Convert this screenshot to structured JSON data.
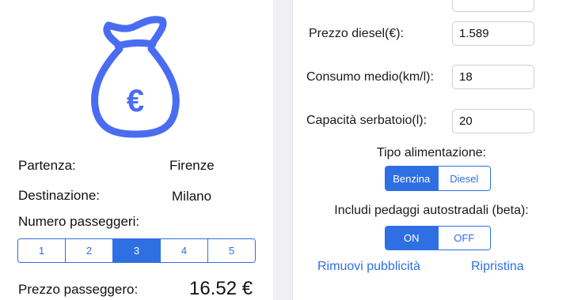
{
  "trip": {
    "partenza_label": "Partenza:",
    "partenza_value": "Firenze",
    "destinazione_label": "Destinazione:",
    "destinazione_value": "Milano",
    "passeggeri_label": "Numero passeggeri:",
    "passeggeri_options": [
      "1",
      "2",
      "3",
      "4",
      "5"
    ],
    "passeggeri_selected": "3",
    "prezzo_label": "Prezzo passeggero:",
    "prezzo_value": "16.52 €"
  },
  "settings": {
    "prezzo_diesel_label": "Prezzo diesel(€):",
    "prezzo_diesel_value": "1.589",
    "consumo_label": "Consumo medio(km/l):",
    "consumo_value": "18",
    "capacita_label": "Capacità serbatoio(l):",
    "capacita_value": "20",
    "alimentazione_label": "Tipo alimentazione:",
    "alimentazione_options": [
      "Benzina",
      "Diesel"
    ],
    "alimentazione_selected": "Benzina",
    "pedaggi_label": "Includi pedaggi autostradali (beta):",
    "pedaggi_options": [
      "ON",
      "OFF"
    ],
    "pedaggi_selected": "ON",
    "rimuovi_label": "Rimuovi pubblicità",
    "ripristina_label": "Ripristina"
  },
  "icons": {
    "logo": "money-bag-euro-icon"
  },
  "colors": {
    "accent": "#2f6fe4",
    "logo": "#4a6cf0",
    "background": "#efeff4"
  }
}
